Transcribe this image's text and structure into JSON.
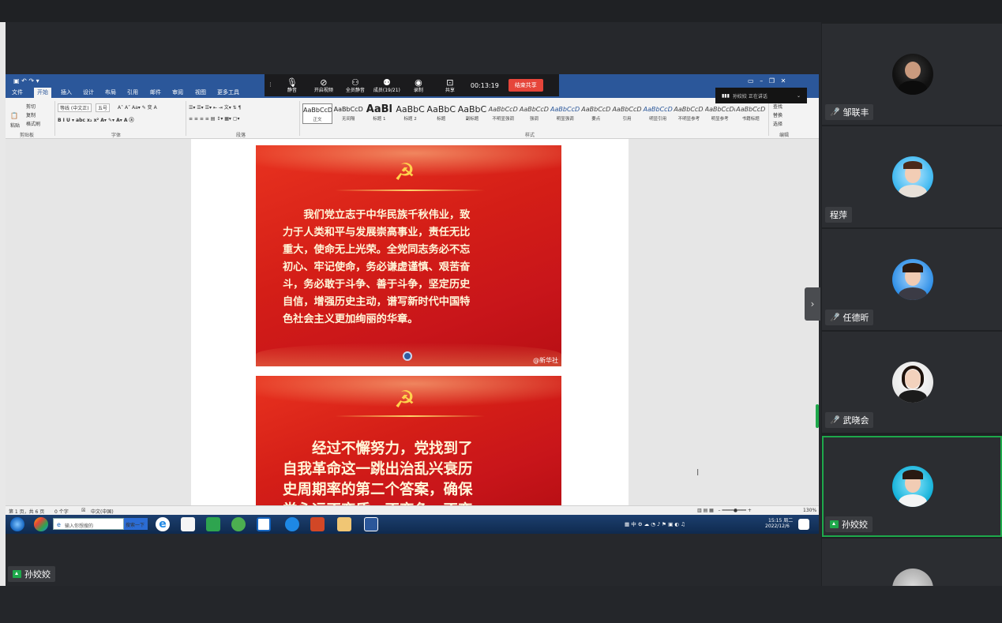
{
  "meeting": {
    "presenter_label": "孙姣姣",
    "toolbar": {
      "items": [
        {
          "label": "静音",
          "icon": "microphone-icon"
        },
        {
          "label": "开启视频",
          "icon": "video-off-icon"
        },
        {
          "label": "全员静音",
          "icon": "mute-all-icon"
        },
        {
          "label": "成员(19/21)",
          "icon": "participants-icon"
        },
        {
          "label": "录制",
          "icon": "record-icon"
        },
        {
          "label": "共享",
          "icon": "share-icon"
        }
      ],
      "timer": "00:13:19",
      "end_share_label": "结束共享"
    },
    "speaker_pill": "孙姣姣 正在讲话",
    "participants": [
      {
        "name": "邹联丰",
        "mic": "muted"
      },
      {
        "name": "程萍",
        "mic": "none"
      },
      {
        "name": "任德昕",
        "mic": "muted"
      },
      {
        "name": "武晓会",
        "mic": "muted"
      },
      {
        "name": "孙姣姣",
        "mic": "sharing",
        "active": true
      },
      {
        "name": "",
        "mic": "none"
      }
    ]
  },
  "word": {
    "tabs": [
      "文件",
      "开始",
      "插入",
      "设计",
      "布局",
      "引用",
      "邮件",
      "审阅",
      "视图",
      "更多工具"
    ],
    "active_tab": "开始",
    "ribbon": {
      "clipboard": {
        "paste": "粘贴",
        "cut": "剪切",
        "copy": "复制",
        "format_painter": "格式刷",
        "group": "剪贴板"
      },
      "font": {
        "name": "等线 (中文正)",
        "size": "五号",
        "group": "字体"
      },
      "paragraph_group": "段落",
      "styles_group": "样式",
      "styles": [
        {
          "sample": "AaBbCcD",
          "label": "正文"
        },
        {
          "sample": "AaBbCcD",
          "label": "无间隔"
        },
        {
          "sample": "AaBl",
          "label": "标题 1"
        },
        {
          "sample": "AaBbC",
          "label": "标题 2"
        },
        {
          "sample": "AaBbC",
          "label": "标题"
        },
        {
          "sample": "AaBbC",
          "label": "副标题"
        },
        {
          "sample": "AaBbCcD",
          "label": "不明显强调"
        },
        {
          "sample": "AaBbCcD",
          "label": "强调"
        },
        {
          "sample": "AaBbCcD",
          "label": "明显强调"
        },
        {
          "sample": "AaBbCcD",
          "label": "要点"
        },
        {
          "sample": "AaBbCcD",
          "label": "引用"
        },
        {
          "sample": "AaBbCcD",
          "label": "明显引用"
        },
        {
          "sample": "AaBbCcDi",
          "label": "不明显参考"
        },
        {
          "sample": "AaBbCcDi",
          "label": "明显参考"
        },
        {
          "sample": "AaBbCcD",
          "label": "书籍标题"
        }
      ],
      "editing": {
        "find": "查找",
        "replace": "替换",
        "select": "选择",
        "group": "编辑"
      }
    },
    "poster1": {
      "text": "我们党立志于中华民族千秋伟业，致力于人类和平与发展崇高事业，责任无比重大，使命无上光荣。全党同志务必不忘初心、牢记使命，务必谦虚谨慎、艰苦奋斗，务必敢于斗争、善于斗争，坚定历史自信，增强历史主动，谱写新时代中国特色社会主义更加绚丽的华章。",
      "lines": [
        "　　我们党立志于中华民族千秋伟业，致",
        "力于人类和平与发展崇高事业，责任无比",
        "重大，使命无上光荣。全党同志务必不忘",
        "初心、牢记使命，务必谦虚谨慎、艰苦奋",
        "斗，务必敢于斗争、善于斗争，坚定历史",
        "自信，增强历史主动，谱写新时代中国特",
        "色社会主义更加绚丽的华章。"
      ],
      "watermark": "@新华社"
    },
    "poster2": {
      "lines": [
        "　　经过不懈努力，党找到了",
        "自我革命这一跳出治乱兴衰历",
        "史周期率的第二个答案，确保",
        "党永远不变质、不变色、不变"
      ]
    },
    "status": {
      "page": "第 1 页，共 6 页",
      "words": "0 个字",
      "language": "中文(中国)",
      "zoom": "130%"
    },
    "taskbar": {
      "search_placeholder": "输入你想搜的",
      "search_button": "搜索一下",
      "clock_time": "15:15 周二",
      "clock_date": "2022/12/6",
      "tray_text": "中"
    }
  }
}
